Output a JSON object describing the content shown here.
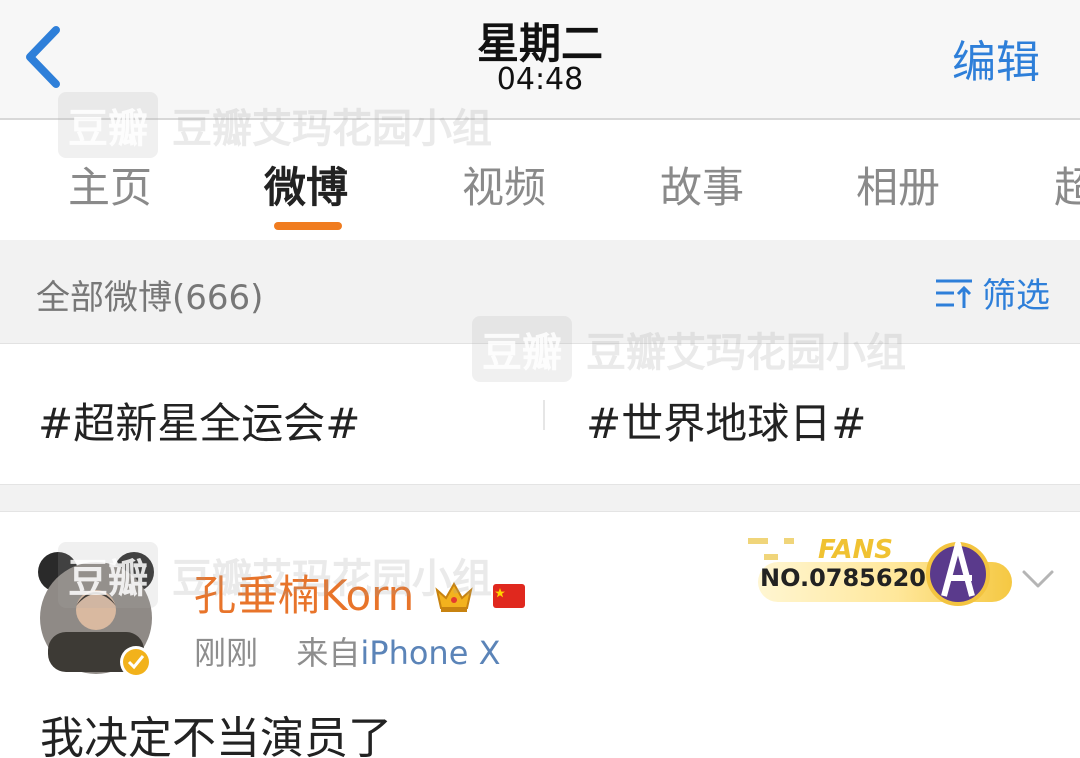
{
  "nav": {
    "title": "星期二",
    "time": "04:48",
    "edit_label": "编辑"
  },
  "tabs": [
    {
      "label": "主页",
      "active": false
    },
    {
      "label": "微博",
      "active": true
    },
    {
      "label": "视频",
      "active": false
    },
    {
      "label": "故事",
      "active": false
    },
    {
      "label": "相册",
      "active": false
    },
    {
      "label": "超",
      "active": false
    }
  ],
  "filter": {
    "all_label": "全部微博(666)",
    "filter_label": "筛选"
  },
  "topics": [
    "#超新星全运会#",
    "#世界地球日#"
  ],
  "post": {
    "username": "孔垂楠Korn",
    "time": "刚刚",
    "source_prefix": "来自",
    "source": "iPhone X",
    "text": "我决定不当演员了",
    "fans_label": "FANS",
    "fans_no": "NO.0785620"
  },
  "watermark": {
    "logo": "豆瓣",
    "text": "豆瓣艾玛花园小组"
  },
  "colors": {
    "accent_blue": "#2e7fd9",
    "accent_orange": "#e8742a",
    "tab_indicator": "#f07c1f"
  }
}
